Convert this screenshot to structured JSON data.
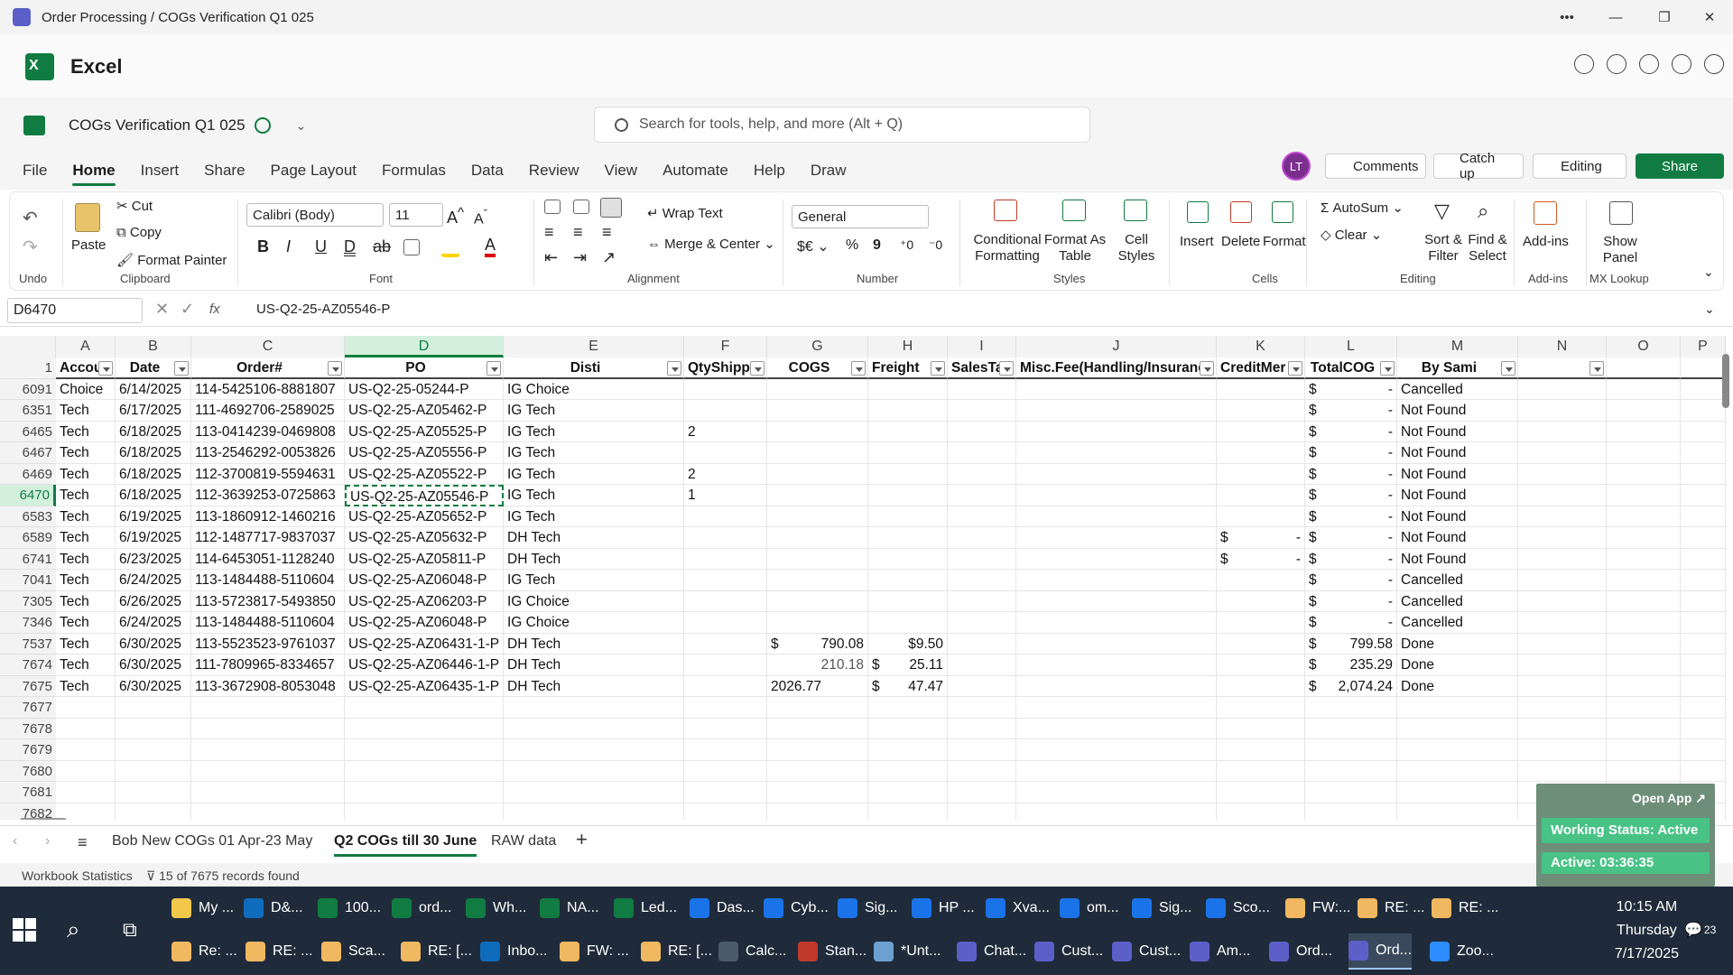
{
  "window": {
    "title": "Order Processing / COGs Verification Q1 025",
    "controls": [
      "more-icon",
      "minimize-icon",
      "restore-icon",
      "close-icon"
    ]
  },
  "app": {
    "name": "Excel"
  },
  "document": {
    "name": "COGs Verification Q1 025"
  },
  "search": {
    "placeholder": "Search for tools, help, and more (Alt + Q)"
  },
  "menu": [
    "File",
    "Home",
    "Insert",
    "Share",
    "Page Layout",
    "Formulas",
    "Data",
    "Review",
    "View",
    "Automate",
    "Help",
    "Draw"
  ],
  "menu_active": "Home",
  "header_buttons": {
    "avatar": "LT",
    "comments": "Comments",
    "catchup": "Catch up",
    "editing": "Editing",
    "share": "Share"
  },
  "ribbon": {
    "undo_label": "Undo",
    "clipboard": {
      "paste": "Paste",
      "cut": "Cut",
      "copy": "Copy",
      "format_painter": "Format Painter",
      "label": "Clipboard"
    },
    "font": {
      "name": "Calibri (Body)",
      "size": "11",
      "label": "Font"
    },
    "alignment": {
      "wrap": "Wrap Text",
      "merge": "Merge & Center",
      "label": "Alignment"
    },
    "number": {
      "format": "General",
      "label": "Number"
    },
    "styles": {
      "conditional": "Conditional",
      "formatting": "Formatting",
      "format_as": "Format As",
      "table": "Table",
      "cell": "Cell",
      "styles_word": "Styles",
      "label": "Styles"
    },
    "cells": {
      "insert": "Insert",
      "delete": "Delete",
      "format": "Format",
      "label": "Cells"
    },
    "editing": {
      "autosum": "AutoSum",
      "clear": "Clear",
      "sort": "Sort &",
      "filter": "Filter",
      "find": "Find &",
      "select": "Select",
      "label": "Editing"
    },
    "addins": {
      "addins": "Add-ins",
      "label": "Add-ins"
    },
    "mx": {
      "show": "Show",
      "panel": "Panel",
      "label": "MX Lookup"
    }
  },
  "formula_bar": {
    "name_box": "D6470",
    "fx": "fx",
    "content": "US-Q2-25-AZ05546-P"
  },
  "columns": [
    "A",
    "B",
    "C",
    "D",
    "E",
    "F",
    "G",
    "H",
    "I",
    "J",
    "K",
    "L",
    "M",
    "N",
    "O",
    "P"
  ],
  "selected_column": "D",
  "header_row": {
    "row": "1",
    "cells": [
      "Accou",
      "Date",
      "Order#",
      "PO",
      "Disti",
      "QtyShipp",
      "COGS",
      "Freight",
      "SalesTa",
      "Misc.Fee(Handling/Insuranc",
      "CreditMer",
      "TotalCOG",
      "By Sami",
      "",
      "",
      ""
    ]
  },
  "rows": [
    {
      "n": "6091",
      "a": "Choice",
      "b": "6/14/2025",
      "c": "114-5425106-8881807",
      "d": "US-Q2-25-05244-P",
      "e": "IG Choice",
      "f": "",
      "g1": "",
      "g2": "",
      "h1": "",
      "h2": "",
      "k1": "",
      "k2": "",
      "l1": "$",
      "l2": "-",
      "m": "Cancelled"
    },
    {
      "n": "6351",
      "a": "Tech",
      "b": "6/17/2025",
      "c": "111-4692706-2589025",
      "d": "US-Q2-25-AZ05462-P",
      "e": "IG Tech",
      "f": "",
      "g1": "",
      "g2": "",
      "h1": "",
      "h2": "",
      "k1": "",
      "k2": "",
      "l1": "$",
      "l2": "-",
      "m": "Not Found"
    },
    {
      "n": "6465",
      "a": "Tech",
      "b": "6/18/2025",
      "c": "113-0414239-0469808",
      "d": "US-Q2-25-AZ05525-P",
      "e": "IG Tech",
      "f": "2",
      "g1": "",
      "g2": "",
      "h1": "",
      "h2": "",
      "k1": "",
      "k2": "",
      "l1": "$",
      "l2": "-",
      "m": "Not Found"
    },
    {
      "n": "6467",
      "a": "Tech",
      "b": "6/18/2025",
      "c": "113-2546292-0053826",
      "d": "US-Q2-25-AZ05556-P",
      "e": "IG Tech",
      "f": "",
      "g1": "",
      "g2": "",
      "h1": "",
      "h2": "",
      "k1": "",
      "k2": "",
      "l1": "$",
      "l2": "-",
      "m": "Not Found"
    },
    {
      "n": "6469",
      "a": "Tech",
      "b": "6/18/2025",
      "c": "112-3700819-5594631",
      "d": "US-Q2-25-AZ05522-P",
      "e": "IG Tech",
      "f": "2",
      "g1": "",
      "g2": "",
      "h1": "",
      "h2": "",
      "k1": "",
      "k2": "",
      "l1": "$",
      "l2": "-",
      "m": "Not Found"
    },
    {
      "n": "6470",
      "a": "Tech",
      "b": "6/18/2025",
      "c": "112-3639253-0725863",
      "d": "US-Q2-25-AZ05546-P",
      "e": "IG Tech",
      "f": "1",
      "g1": "",
      "g2": "",
      "h1": "",
      "h2": "",
      "k1": "",
      "k2": "",
      "l1": "$",
      "l2": "-",
      "m": "Not Found",
      "selected": true
    },
    {
      "n": "6583",
      "a": "Tech",
      "b": "6/19/2025",
      "c": "113-1860912-1460216",
      "d": "US-Q2-25-AZ05652-P",
      "e": "IG Tech",
      "f": "",
      "g1": "",
      "g2": "",
      "h1": "",
      "h2": "",
      "k1": "",
      "k2": "",
      "l1": "$",
      "l2": "-",
      "m": "Not Found"
    },
    {
      "n": "6589",
      "a": "Tech",
      "b": "6/19/2025",
      "c": "112-1487717-9837037",
      "d": "US-Q2-25-AZ05632-P",
      "e": "DH Tech",
      "f": "",
      "g1": "",
      "g2": "",
      "h1": "",
      "h2": "",
      "k1": "$",
      "k2": "-",
      "l1": "$",
      "l2": "-",
      "m": "Not Found"
    },
    {
      "n": "6741",
      "a": "Tech",
      "b": "6/23/2025",
      "c": "114-6453051-1128240",
      "d": "US-Q2-25-AZ05811-P",
      "e": "DH Tech",
      "f": "",
      "g1": "",
      "g2": "",
      "h1": "",
      "h2": "",
      "k1": "$",
      "k2": "-",
      "l1": "$",
      "l2": "-",
      "m": "Not Found"
    },
    {
      "n": "7041",
      "a": "Tech",
      "b": "6/24/2025",
      "c": "113-1484488-5110604",
      "d": "US-Q2-25-AZ06048-P",
      "e": "IG Tech",
      "f": "",
      "g1": "",
      "g2": "",
      "h1": "",
      "h2": "",
      "k1": "",
      "k2": "",
      "l1": "$",
      "l2": "-",
      "m": "Cancelled"
    },
    {
      "n": "7305",
      "a": "Tech",
      "b": "6/26/2025",
      "c": "113-5723817-5493850",
      "d": "US-Q2-25-AZ06203-P",
      "e": "IG Choice",
      "f": "",
      "g1": "",
      "g2": "",
      "h1": "",
      "h2": "",
      "k1": "",
      "k2": "",
      "l1": "$",
      "l2": "-",
      "m": "Cancelled"
    },
    {
      "n": "7346",
      "a": "Tech",
      "b": "6/24/2025",
      "c": "113-1484488-5110604",
      "d": "US-Q2-25-AZ06048-P",
      "e": "IG Choice",
      "f": "",
      "g1": "",
      "g2": "",
      "h1": "",
      "h2": "",
      "k1": "",
      "k2": "",
      "l1": "$",
      "l2": "-",
      "m": "Cancelled"
    },
    {
      "n": "7537",
      "a": "Tech",
      "b": "6/30/2025",
      "c": "113-5523523-9761037",
      "d": "US-Q2-25-AZ06431-1-P",
      "e": "DH Tech",
      "f": "",
      "g1": "$",
      "g2": "790.08",
      "h1": "",
      "h2": "$9.50",
      "k1": "",
      "k2": "",
      "l1": "$",
      "l2": "799.58",
      "m": "Done"
    },
    {
      "n": "7674",
      "a": "Tech",
      "b": "6/30/2025",
      "c": "111-7809965-8334657",
      "d": "US-Q2-25-AZ06446-1-P",
      "e": "DH Tech",
      "f": "",
      "g1": "",
      "g2": "210.18",
      "h1": "$",
      "h2": "25.11",
      "k1": "",
      "k2": "",
      "l1": "$",
      "l2": "235.29",
      "m": "Done"
    },
    {
      "n": "7675",
      "a": "Tech",
      "b": "6/30/2025",
      "c": "113-3672908-8053048",
      "d": "US-Q2-25-AZ06435-1-P",
      "e": "DH Tech",
      "f": "",
      "g1": "2026.77",
      "g2": "",
      "h1": "$",
      "h2": "47.47",
      "k1": "",
      "k2": "",
      "l1": "$",
      "l2": "2,074.24",
      "m": "Done"
    }
  ],
  "empty_rows": [
    "7677",
    "7678",
    "7679",
    "7680",
    "7681",
    "7682"
  ],
  "sheet_tabs": [
    "Bob New COGs 01 Apr-23 May",
    "Q2 COGs till 30 June",
    "RAW data"
  ],
  "active_sheet": "Q2 COGs till 30 June",
  "status": {
    "stats": "Workbook Statistics",
    "filter": "15 of 7675 records found"
  },
  "overlay": {
    "open_app": "Open App ↗",
    "working_status": "Working Status: Active",
    "active_time": "Active: 03:36:35"
  },
  "taskbar_row1": [
    "My ...",
    "D&...",
    "100...",
    "ord...",
    "Wh...",
    "NA...",
    "Led...",
    "Das...",
    "Cyb...",
    "Sig...",
    "HP ...",
    "Xva...",
    "om...",
    "Sig...",
    "Sco...",
    "FW:...",
    "RE: ...",
    "RE: ..."
  ],
  "taskbar_row2": [
    "Re: ...",
    "RE: ...",
    "Sca...",
    "RE: [...",
    "Inbo...",
    "FW: ...",
    "RE: [...",
    "Calc...",
    "Stan...",
    "*Unt...",
    "Chat...",
    "Cust...",
    "Cust...",
    "Am...",
    "Ord...",
    "Ord...",
    "Zoo..."
  ],
  "clock": {
    "time": "10:15 AM",
    "day": "Thursday",
    "date": "7/17/2025"
  },
  "notif_count": "23"
}
